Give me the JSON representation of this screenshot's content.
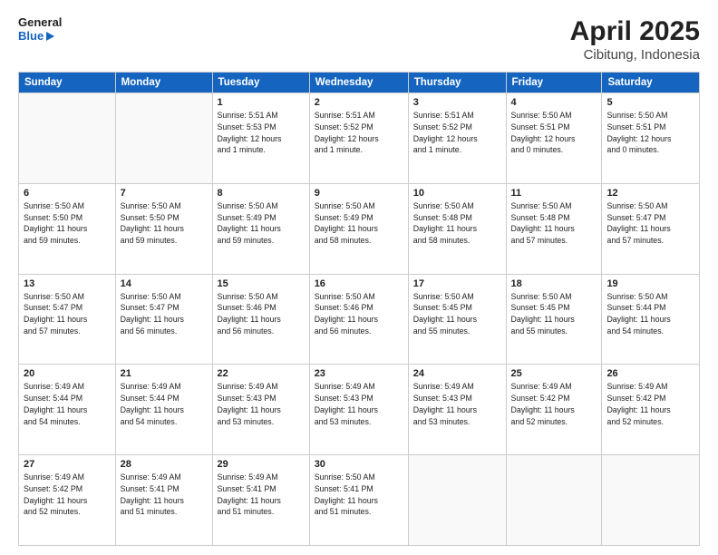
{
  "header": {
    "title": "April 2025",
    "subtitle": "Cibitung, Indonesia",
    "logo_general": "General",
    "logo_blue": "Blue"
  },
  "calendar": {
    "days_of_week": [
      "Sunday",
      "Monday",
      "Tuesday",
      "Wednesday",
      "Thursday",
      "Friday",
      "Saturday"
    ],
    "weeks": [
      [
        {
          "day": "",
          "info": ""
        },
        {
          "day": "",
          "info": ""
        },
        {
          "day": "1",
          "info": "Sunrise: 5:51 AM\nSunset: 5:53 PM\nDaylight: 12 hours\nand 1 minute."
        },
        {
          "day": "2",
          "info": "Sunrise: 5:51 AM\nSunset: 5:52 PM\nDaylight: 12 hours\nand 1 minute."
        },
        {
          "day": "3",
          "info": "Sunrise: 5:51 AM\nSunset: 5:52 PM\nDaylight: 12 hours\nand 1 minute."
        },
        {
          "day": "4",
          "info": "Sunrise: 5:50 AM\nSunset: 5:51 PM\nDaylight: 12 hours\nand 0 minutes."
        },
        {
          "day": "5",
          "info": "Sunrise: 5:50 AM\nSunset: 5:51 PM\nDaylight: 12 hours\nand 0 minutes."
        }
      ],
      [
        {
          "day": "6",
          "info": "Sunrise: 5:50 AM\nSunset: 5:50 PM\nDaylight: 11 hours\nand 59 minutes."
        },
        {
          "day": "7",
          "info": "Sunrise: 5:50 AM\nSunset: 5:50 PM\nDaylight: 11 hours\nand 59 minutes."
        },
        {
          "day": "8",
          "info": "Sunrise: 5:50 AM\nSunset: 5:49 PM\nDaylight: 11 hours\nand 59 minutes."
        },
        {
          "day": "9",
          "info": "Sunrise: 5:50 AM\nSunset: 5:49 PM\nDaylight: 11 hours\nand 58 minutes."
        },
        {
          "day": "10",
          "info": "Sunrise: 5:50 AM\nSunset: 5:48 PM\nDaylight: 11 hours\nand 58 minutes."
        },
        {
          "day": "11",
          "info": "Sunrise: 5:50 AM\nSunset: 5:48 PM\nDaylight: 11 hours\nand 57 minutes."
        },
        {
          "day": "12",
          "info": "Sunrise: 5:50 AM\nSunset: 5:47 PM\nDaylight: 11 hours\nand 57 minutes."
        }
      ],
      [
        {
          "day": "13",
          "info": "Sunrise: 5:50 AM\nSunset: 5:47 PM\nDaylight: 11 hours\nand 57 minutes."
        },
        {
          "day": "14",
          "info": "Sunrise: 5:50 AM\nSunset: 5:47 PM\nDaylight: 11 hours\nand 56 minutes."
        },
        {
          "day": "15",
          "info": "Sunrise: 5:50 AM\nSunset: 5:46 PM\nDaylight: 11 hours\nand 56 minutes."
        },
        {
          "day": "16",
          "info": "Sunrise: 5:50 AM\nSunset: 5:46 PM\nDaylight: 11 hours\nand 56 minutes."
        },
        {
          "day": "17",
          "info": "Sunrise: 5:50 AM\nSunset: 5:45 PM\nDaylight: 11 hours\nand 55 minutes."
        },
        {
          "day": "18",
          "info": "Sunrise: 5:50 AM\nSunset: 5:45 PM\nDaylight: 11 hours\nand 55 minutes."
        },
        {
          "day": "19",
          "info": "Sunrise: 5:50 AM\nSunset: 5:44 PM\nDaylight: 11 hours\nand 54 minutes."
        }
      ],
      [
        {
          "day": "20",
          "info": "Sunrise: 5:49 AM\nSunset: 5:44 PM\nDaylight: 11 hours\nand 54 minutes."
        },
        {
          "day": "21",
          "info": "Sunrise: 5:49 AM\nSunset: 5:44 PM\nDaylight: 11 hours\nand 54 minutes."
        },
        {
          "day": "22",
          "info": "Sunrise: 5:49 AM\nSunset: 5:43 PM\nDaylight: 11 hours\nand 53 minutes."
        },
        {
          "day": "23",
          "info": "Sunrise: 5:49 AM\nSunset: 5:43 PM\nDaylight: 11 hours\nand 53 minutes."
        },
        {
          "day": "24",
          "info": "Sunrise: 5:49 AM\nSunset: 5:43 PM\nDaylight: 11 hours\nand 53 minutes."
        },
        {
          "day": "25",
          "info": "Sunrise: 5:49 AM\nSunset: 5:42 PM\nDaylight: 11 hours\nand 52 minutes."
        },
        {
          "day": "26",
          "info": "Sunrise: 5:49 AM\nSunset: 5:42 PM\nDaylight: 11 hours\nand 52 minutes."
        }
      ],
      [
        {
          "day": "27",
          "info": "Sunrise: 5:49 AM\nSunset: 5:42 PM\nDaylight: 11 hours\nand 52 minutes."
        },
        {
          "day": "28",
          "info": "Sunrise: 5:49 AM\nSunset: 5:41 PM\nDaylight: 11 hours\nand 51 minutes."
        },
        {
          "day": "29",
          "info": "Sunrise: 5:49 AM\nSunset: 5:41 PM\nDaylight: 11 hours\nand 51 minutes."
        },
        {
          "day": "30",
          "info": "Sunrise: 5:50 AM\nSunset: 5:41 PM\nDaylight: 11 hours\nand 51 minutes."
        },
        {
          "day": "",
          "info": ""
        },
        {
          "day": "",
          "info": ""
        },
        {
          "day": "",
          "info": ""
        }
      ]
    ]
  }
}
